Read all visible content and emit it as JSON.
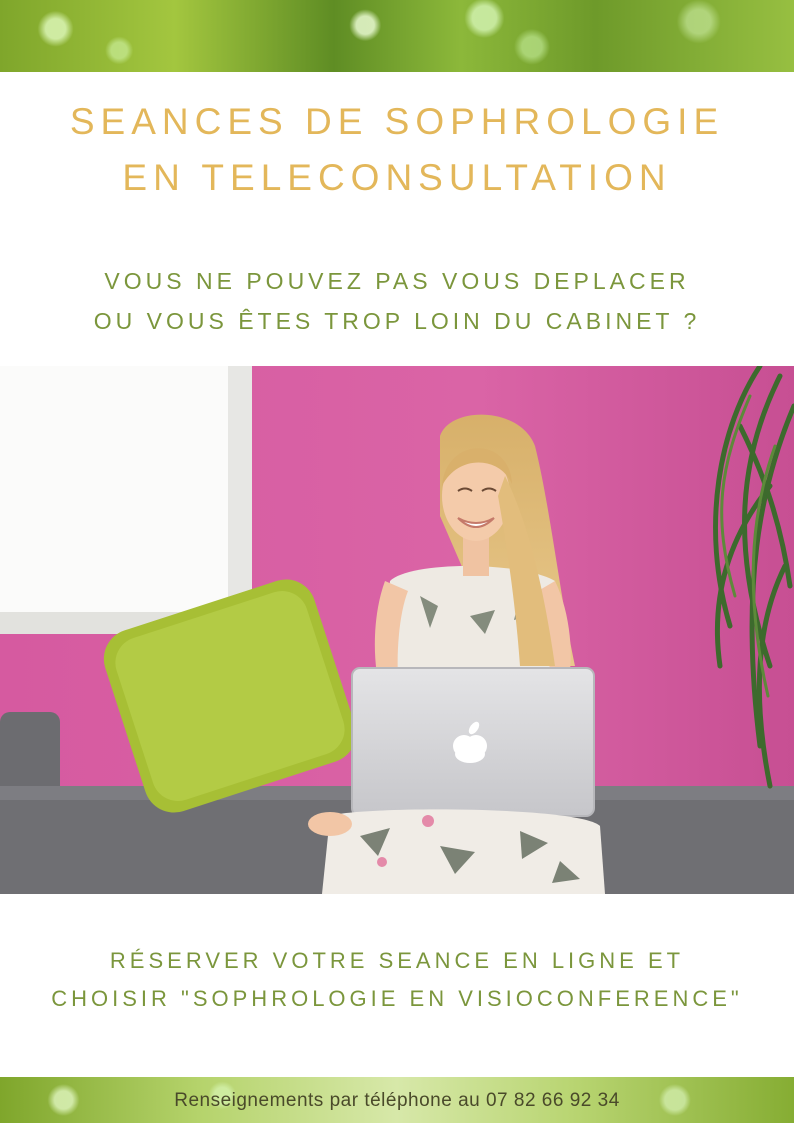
{
  "header": {
    "title_line1": "SEANCES DE SOPHROLOGIE",
    "title_line2": "EN TELECONSULTATION"
  },
  "intro": {
    "line1": "VOUS NE POUVEZ PAS VOUS DEPLACER",
    "line2": "OU VOUS ÊTES TROP LOIN DU CABINET ?"
  },
  "call_to_action": {
    "line1": "RÉSERVER VOTRE SEANCE EN LIGNE ET",
    "line2": "CHOISIR \"SOPHROLOGIE EN VISIOCONFERENCE\""
  },
  "footer": {
    "contact": "Renseignements par téléphone au 07 82 66 92 34"
  },
  "icons": {
    "laptop_logo": "apple-icon"
  },
  "colors": {
    "title": "#e3b75a",
    "subtitle": "#7b963c",
    "wall": "#d6609f",
    "cushion": "#a7bf35"
  }
}
